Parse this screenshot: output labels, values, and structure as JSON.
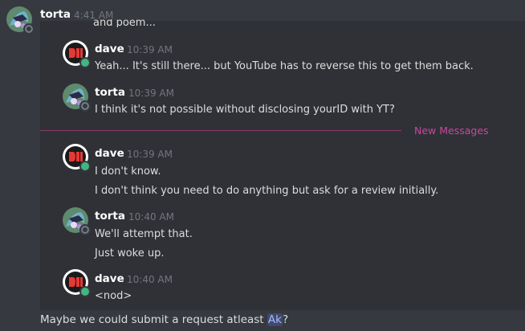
{
  "outer": {
    "username": "torta",
    "time": "4:41 AM",
    "cut_line": "and poem..."
  },
  "thread": {
    "messages": [
      {
        "user": "dave",
        "time": "10:39 AM",
        "lines": [
          "Yeah... It's still there... but YouTube has to reverse this to get them back."
        ]
      },
      {
        "user": "torta",
        "time": "10:39 AM",
        "lines": [
          "I think it's not possible without disclosing yourID with YT?"
        ]
      },
      {
        "user": "dave",
        "time": "10:39 AM",
        "lines": [
          "I don't know.",
          "I don't think you need to do anything but ask for a review initially."
        ]
      },
      {
        "user": "torta",
        "time": "10:40 AM",
        "lines": [
          "We'll attempt that.",
          "Just woke up."
        ]
      },
      {
        "user": "dave",
        "time": "10:40 AM",
        "lines": [
          "<nod>"
        ]
      }
    ],
    "new_messages_label": "New Messages"
  },
  "bottom": {
    "text_before": "Maybe we could submit a request atleast ",
    "mention": "Ak",
    "text_after": "?"
  },
  "colors": {
    "background": "#36393f",
    "thread_bg": "#2f3136",
    "new_messages": "#c8479f",
    "online": "#43b581"
  }
}
